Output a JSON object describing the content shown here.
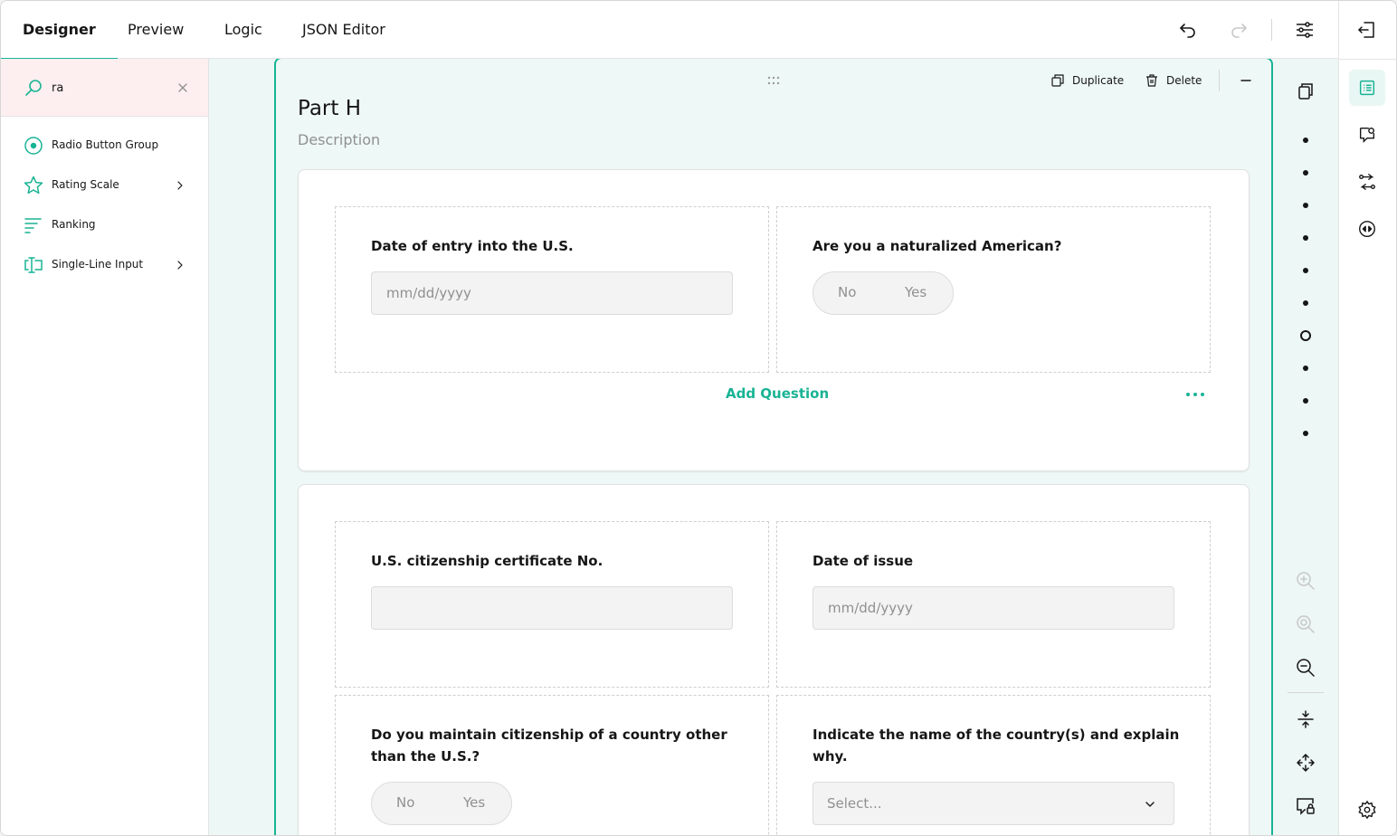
{
  "tabs": [
    {
      "label": "Designer",
      "active": true
    },
    {
      "label": "Preview"
    },
    {
      "label": "Logic"
    },
    {
      "label": "JSON Editor"
    }
  ],
  "toolbox": {
    "search_value": "ra",
    "items": [
      {
        "label": "Radio Button Group",
        "icon": "radio-button-icon",
        "has_submenu": false
      },
      {
        "label": "Rating Scale",
        "icon": "star-icon",
        "has_submenu": true
      },
      {
        "label": "Ranking",
        "icon": "ranking-icon",
        "has_submenu": false
      },
      {
        "label": "Single-Line Input",
        "icon": "text-input-icon",
        "has_submenu": true
      }
    ]
  },
  "page": {
    "title": "Part H",
    "description": "Description",
    "duplicate_label": "Duplicate",
    "delete_label": "Delete"
  },
  "panel1": {
    "q1": {
      "title": "Date of entry into the U.S.",
      "placeholder": "mm/dd/yyyy"
    },
    "q2": {
      "title": "Are you a naturalized American?",
      "false_label": "No",
      "true_label": "Yes"
    },
    "add_question": "Add Question"
  },
  "panel2": {
    "q1": {
      "title": "U.S. citizenship certificate No.",
      "placeholder": ""
    },
    "q2": {
      "title": "Date of issue",
      "placeholder": "mm/dd/yyyy"
    },
    "q3": {
      "title": "Do you maintain citizenship of a country other than the U.S.?",
      "false_label": "No",
      "true_label": "Yes"
    },
    "q4": {
      "title": "Indicate the name of the country(s) and explain why.",
      "placeholder": "Select..."
    }
  },
  "navigator": {
    "page_count": 10,
    "current_page_index": 6
  },
  "colors": {
    "accent": "#19b394",
    "text": "#161616",
    "placeholder": "#909090",
    "search_bg": "#fdeff0"
  }
}
